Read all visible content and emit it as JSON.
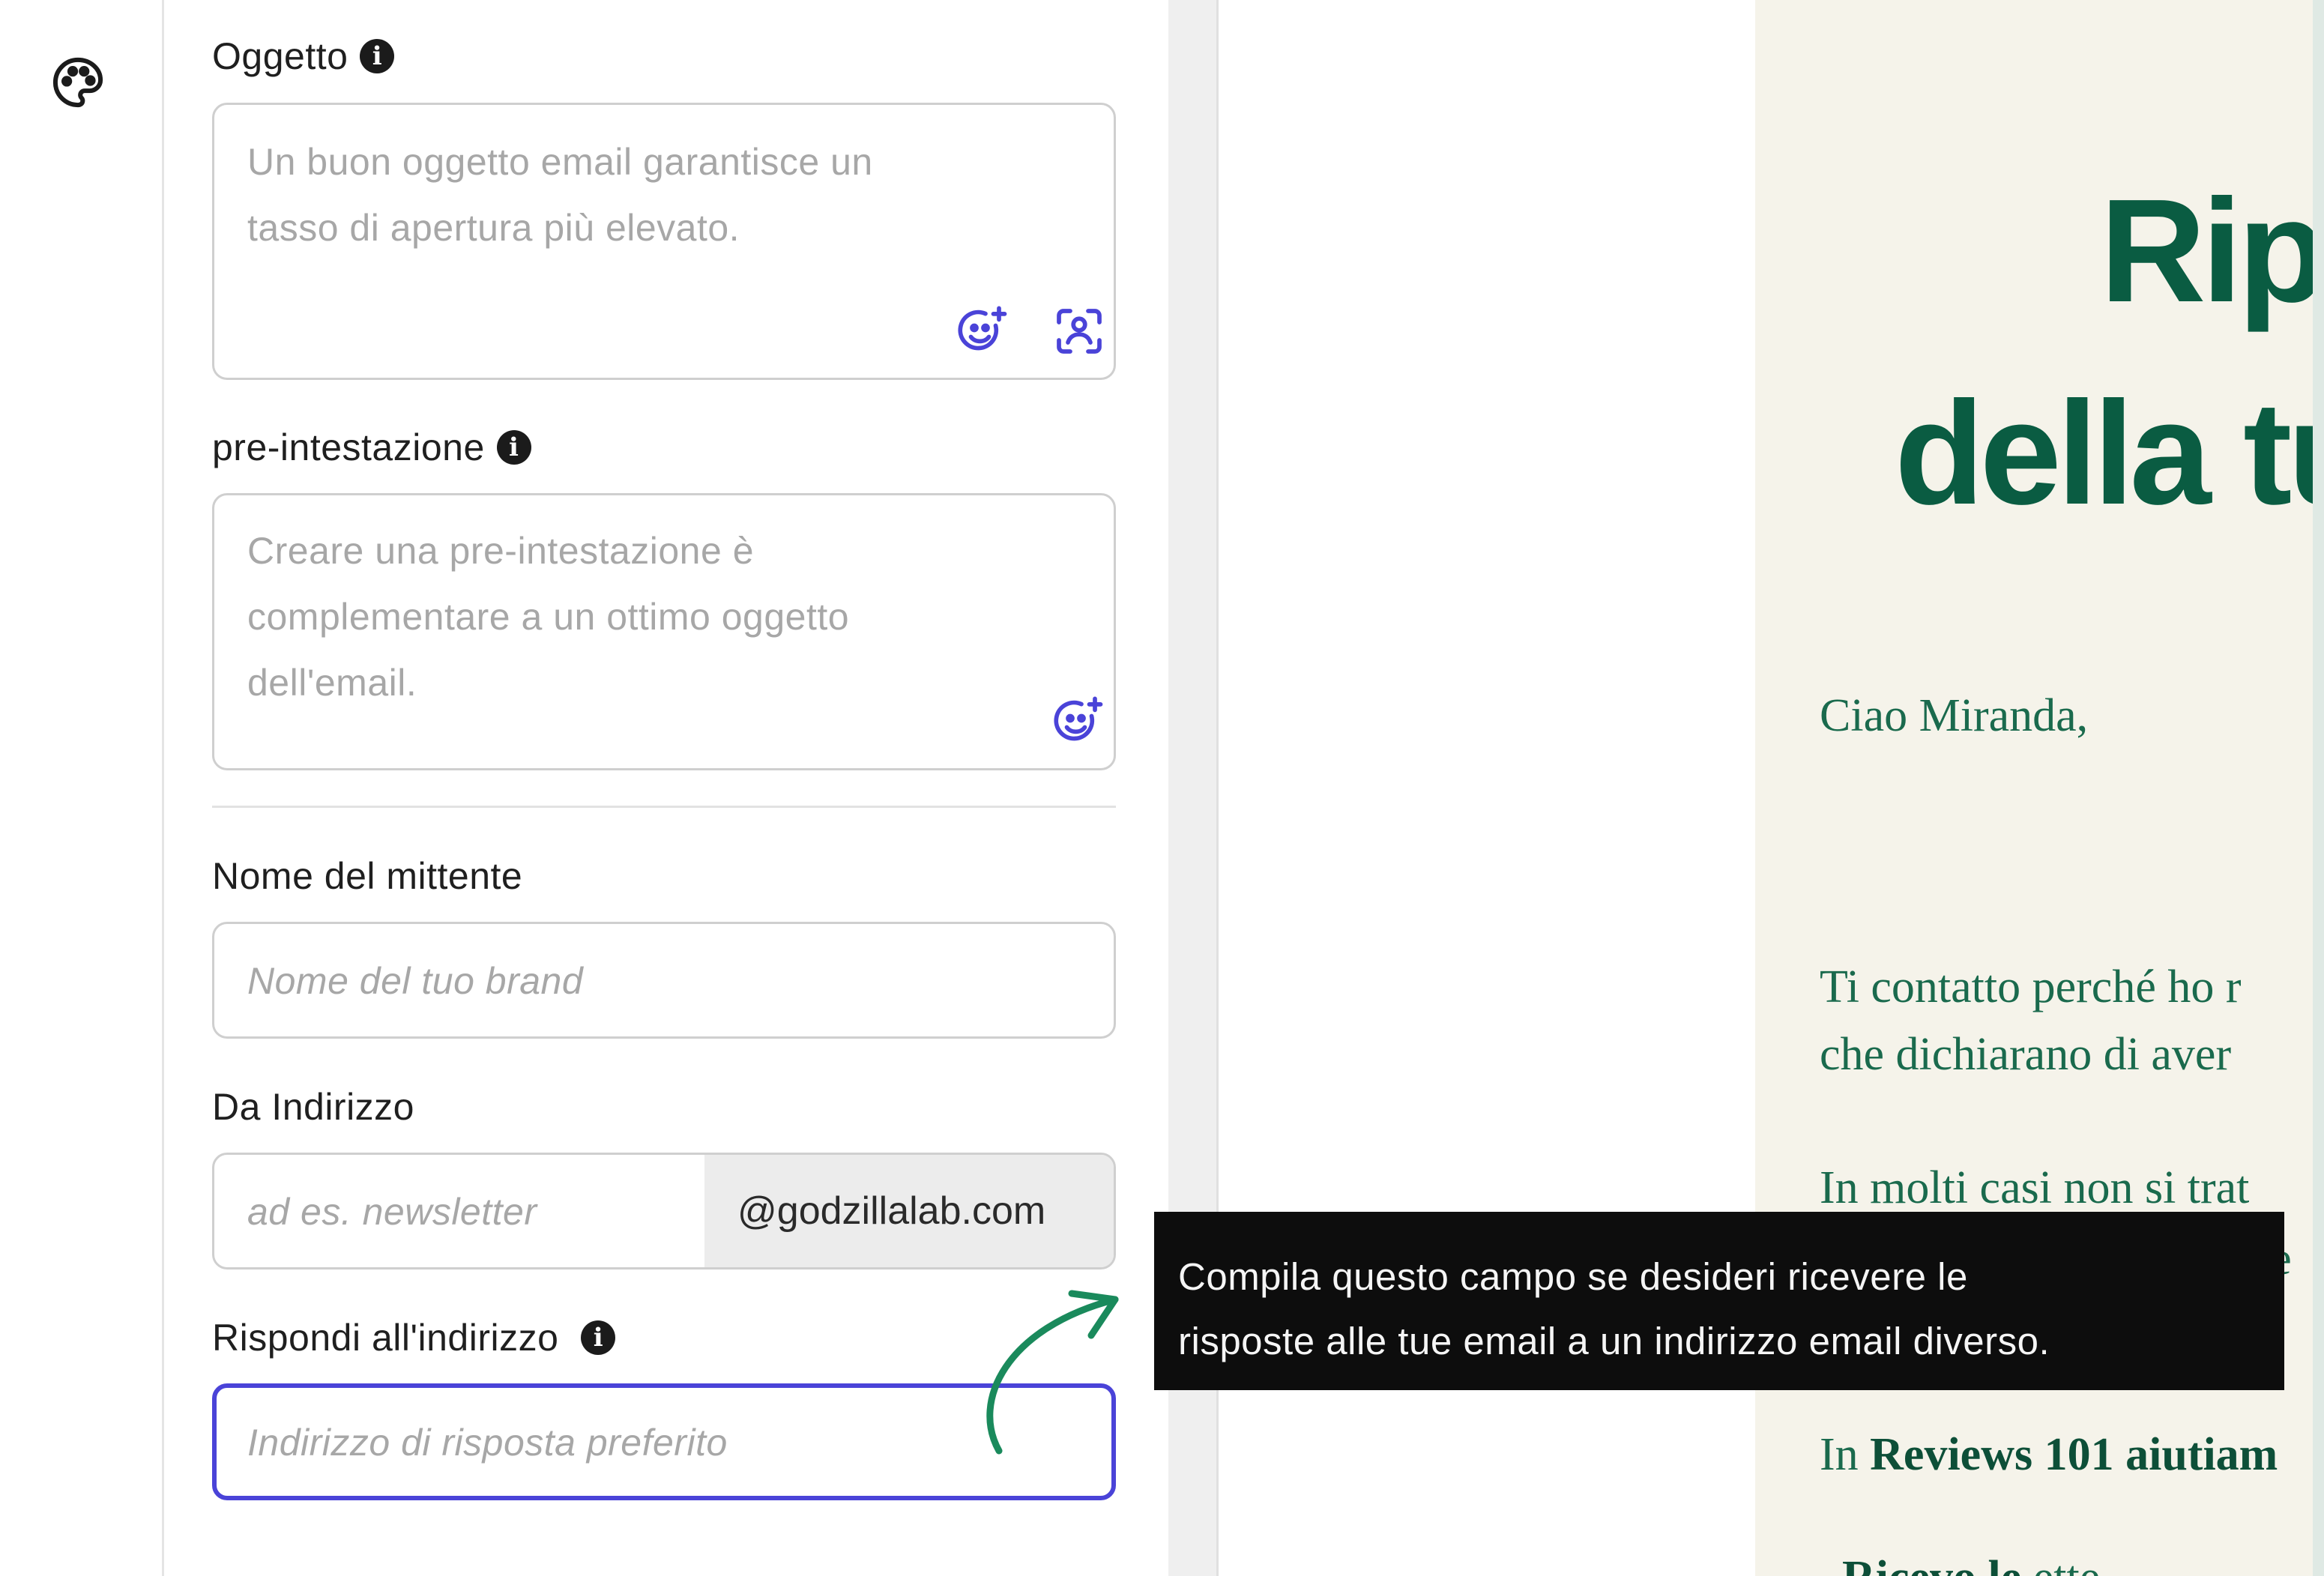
{
  "sidebar": {
    "icon": "palette-icon"
  },
  "form": {
    "subject": {
      "label": "Oggetto",
      "placeholder_line1": "Un buon oggetto email garantisce un",
      "placeholder_line2": "tasso di apertura più elevato."
    },
    "preheader": {
      "label": "pre-intestazione",
      "placeholder_line1": "Creare una pre-intestazione è",
      "placeholder_line2": "complementare a un ottimo oggetto",
      "placeholder_line3": "dell'email."
    },
    "sender_name": {
      "label": "Nome del mittente",
      "placeholder": "Nome del tuo brand"
    },
    "from_address": {
      "label": "Da Indirizzo",
      "placeholder": "ad es. newsletter",
      "domain": "@godzillalab.com"
    },
    "reply_to": {
      "label": "Rispondi all'indirizzo",
      "placeholder": "Indirizzo di risposta preferito"
    }
  },
  "tooltip": {
    "line1": "Compila questo campo se desideri ricevere le",
    "line2": "risposte alle tue email a un indirizzo email diverso."
  },
  "email_preview": {
    "title_line1": "Ripr",
    "title_line2": "della tu",
    "greeting": "Ciao Miranda,",
    "p1_line1": "Ti contatto perché ho r",
    "p1_line2": "che dichiarano di aver",
    "p2_line1": "In molti casi non si trat",
    "p2_line2": "pie",
    "p3_prefix": "In ",
    "p3_bold": "Reviews 101 aiutiam",
    "p4_bold": "Ricevo le",
    "p4_text": "ette"
  },
  "colors": {
    "accent": "#4a43d8",
    "focus_border": "#4a43d8",
    "email_green": "#0a5c42",
    "email_bg": "#f5f3ea",
    "arrow_green": "#1a8a5c",
    "tooltip_bg": "#0d0d0d"
  }
}
